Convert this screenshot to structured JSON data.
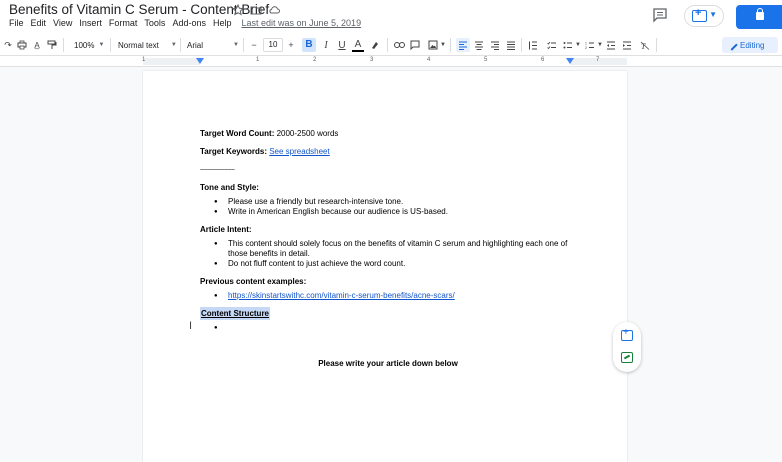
{
  "app": {
    "doc_title": "Benefits of Vitamin C Serum - Content Brief",
    "menu": [
      "File",
      "Edit",
      "View",
      "Insert",
      "Format",
      "Tools",
      "Add-ons",
      "Help"
    ],
    "last_edit": "Last edit was on June 5, 2019"
  },
  "toolbar": {
    "zoom": "100%",
    "style": "Normal text",
    "font": "Arial",
    "font_size": "10",
    "mode": "Editing"
  },
  "ruler": {
    "numbers": [
      "1",
      "1",
      "2",
      "3",
      "4",
      "5",
      "6",
      "7"
    ]
  },
  "document": {
    "word_count_label": "Target Word Count:",
    "word_count_value": " 2000-2500 words",
    "keywords_label": "Target Keywords:",
    "keywords_link": "See spreadsheet",
    "divider": "-----------------------",
    "tone_heading": "Tone and Style:",
    "tone_items": [
      "Please use a friendly but research-intensive tone.",
      "Write in American English because our audience is US-based."
    ],
    "intent_heading": "Article Intent:",
    "intent_items": [
      "This content should solely focus on the benefits of vitamin C serum and highlighting each one of those benefits in detail.",
      "Do not fluff content to just achieve the word count."
    ],
    "examples_heading": "Previous content examples:",
    "examples_link": "https://skinstartswithc.com/vitamin-c-serum-benefits/acne-scars/",
    "structure_heading": "Content Structure",
    "closing_line": "Please write your article down below"
  },
  "colors": {
    "accent": "#1a73e8",
    "link": "#1155cc",
    "selection": "#c6d8f5"
  }
}
